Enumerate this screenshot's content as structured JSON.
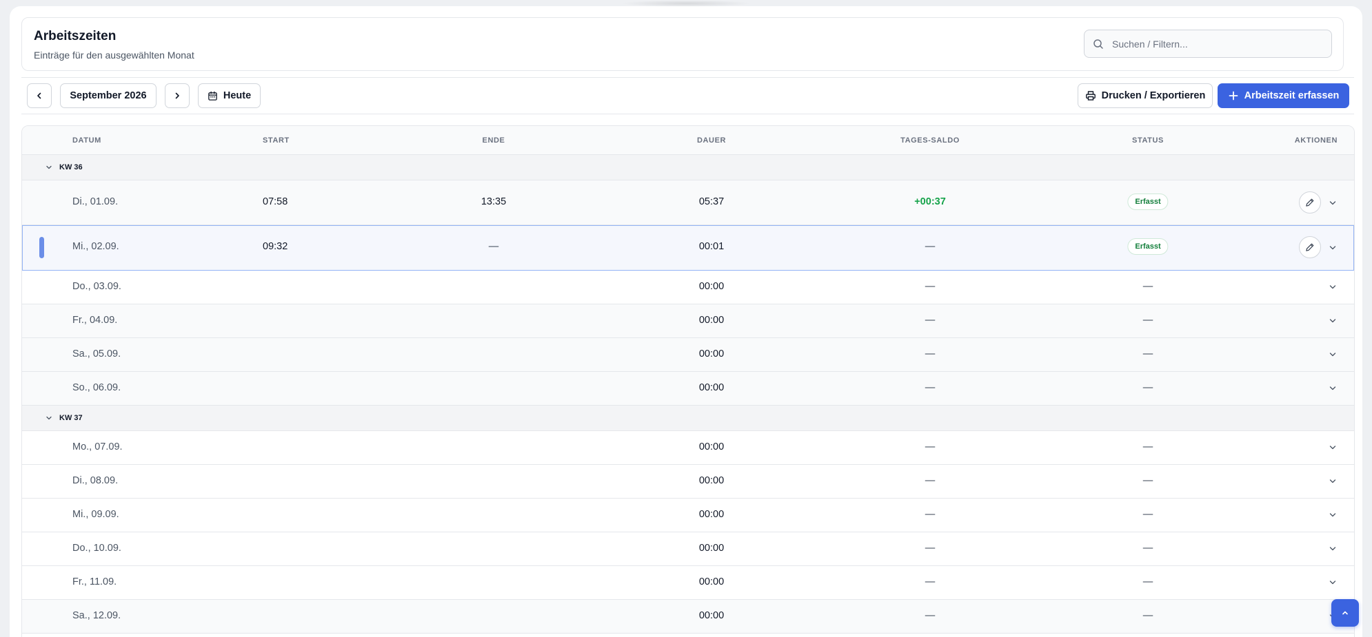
{
  "header": {
    "title": "Arbeitszeiten",
    "subtitle": "Einträge für den ausgewählten Monat",
    "search_placeholder": "Suchen / Filtern..."
  },
  "toolbar": {
    "prev_icon": "chevron-left-icon",
    "month_label": "September 2026",
    "next_icon": "chevron-right-icon",
    "today_label": "Heute",
    "print_label": "Drucken / Exportieren",
    "add_label": "Arbeitszeit erfassen"
  },
  "table": {
    "columns": [
      "DATUM",
      "START",
      "ENDE",
      "DAUER",
      "TAGES-SALDO",
      "STATUS",
      "AKTIONEN"
    ],
    "groups": [
      {
        "label": "KW 36",
        "rows": [
          {
            "date": "Di., 01.09.",
            "start": "07:58",
            "end": "13:35",
            "duration": "05:37",
            "saldo": "+00:37",
            "saldo_positive": true,
            "status": "Erfasst",
            "editable": true
          },
          {
            "date": "Mi., 02.09.",
            "start": "09:32",
            "end": "—",
            "duration": "00:01",
            "saldo": "—",
            "status": "Erfasst",
            "editable": true,
            "selected": true
          },
          {
            "date": "Do., 03.09.",
            "start": "",
            "end": "",
            "duration": "00:00",
            "saldo": "—",
            "status_text": "—"
          },
          {
            "date": "Fr., 04.09.",
            "start": "",
            "end": "",
            "duration": "00:00",
            "saldo": "—",
            "status_text": "—"
          },
          {
            "date": "Sa., 05.09.",
            "start": "",
            "end": "",
            "duration": "00:00",
            "saldo": "—",
            "status_text": "—"
          },
          {
            "date": "So., 06.09.",
            "start": "",
            "end": "",
            "duration": "00:00",
            "saldo": "—",
            "status_text": "—"
          }
        ]
      },
      {
        "label": "KW 37",
        "rows": [
          {
            "date": "Mo., 07.09.",
            "start": "",
            "end": "",
            "duration": "00:00",
            "saldo": "—",
            "status_text": "—"
          },
          {
            "date": "Di., 08.09.",
            "start": "",
            "end": "",
            "duration": "00:00",
            "saldo": "—",
            "status_text": "—"
          },
          {
            "date": "Mi., 09.09.",
            "start": "",
            "end": "",
            "duration": "00:00",
            "saldo": "—",
            "status_text": "—"
          },
          {
            "date": "Do., 10.09.",
            "start": "",
            "end": "",
            "duration": "00:00",
            "saldo": "—",
            "status_text": "—"
          },
          {
            "date": "Fr., 11.09.",
            "start": "",
            "end": "",
            "duration": "00:00",
            "saldo": "—",
            "status_text": "—"
          },
          {
            "date": "Sa., 12.09.",
            "start": "",
            "end": "",
            "duration": "00:00",
            "saldo": "—",
            "status_text": "—"
          }
        ]
      }
    ]
  },
  "colors": {
    "accent": "#3b63e0",
    "positive": "#16a34a",
    "badge_text": "#15803d"
  }
}
